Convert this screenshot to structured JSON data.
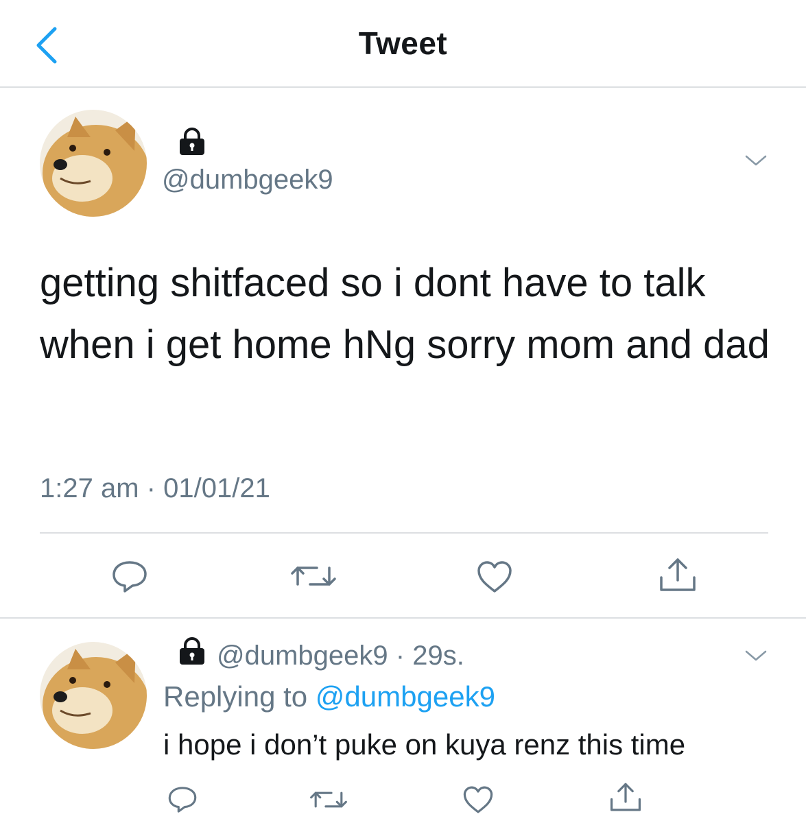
{
  "header": {
    "title": "Tweet",
    "back_icon": "chevron-left-icon"
  },
  "main_tweet": {
    "handle": "@dumbgeek9",
    "protected_icon": "lock-icon",
    "text": "getting shitfaced so i dont have to talk when i get home hNg sorry mom and dad",
    "time": "1:27 am",
    "separator": "·",
    "date": "01/01/21",
    "more_icon": "chevron-down-icon",
    "actions": [
      "reply-icon",
      "retweet-icon",
      "like-icon",
      "share-icon"
    ]
  },
  "reply": {
    "handle": "@dumbgeek9",
    "separator": "·",
    "age": "29s.",
    "replying_prefix": "Replying to",
    "replying_to": "@dumbgeek9",
    "text": "i hope i don’t puke on kuya renz this time",
    "more_icon": "chevron-down-icon",
    "actions": [
      "reply-icon",
      "retweet-icon",
      "like-icon",
      "share-icon"
    ]
  },
  "colors": {
    "accent": "#1da1f2",
    "secondary_text": "#657786",
    "primary_text": "#14171a",
    "divider": "#dcdfe2"
  }
}
